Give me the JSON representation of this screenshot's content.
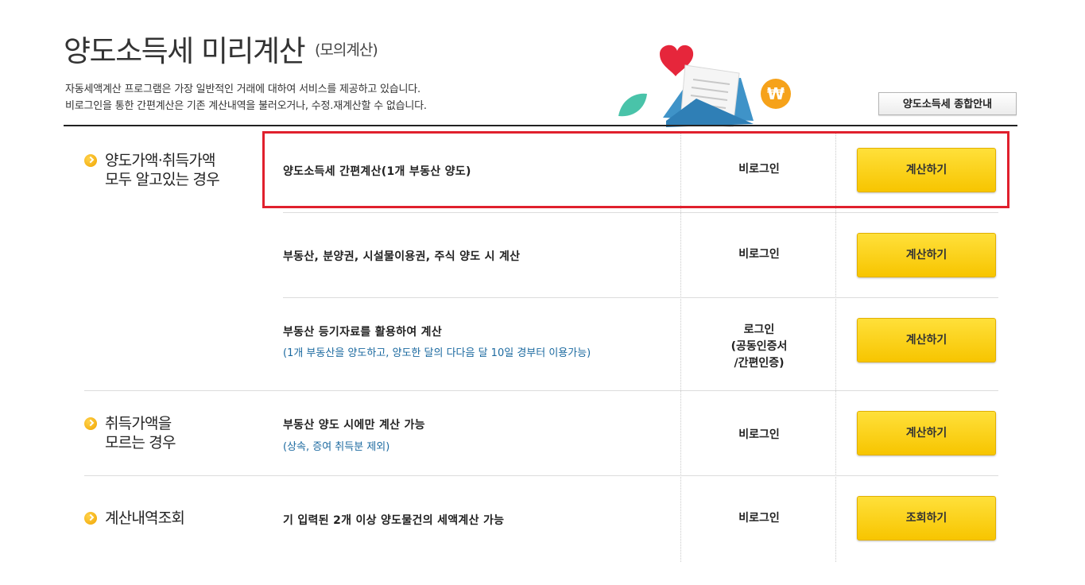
{
  "header": {
    "title": "양도소득세 미리계산",
    "subtitle": "(모의계산)",
    "desc_line1": "자동세액계산 프로그램은 가장 일반적인 거래에 대하여 서비스를 제공하고 있습니다.",
    "desc_line2": "비로그인을 통한 간편계산은 기존 계산내역을 불러오거나, 수정.재계산할 수 없습니다.",
    "guide_button": "양도소득세 종합안내"
  },
  "categories": [
    {
      "line1": "양도가액·취득가액",
      "line2": "모두 알고있는 경우"
    },
    {
      "line1": "취득가액을",
      "line2": "모르는 경우"
    },
    {
      "line1": "계산내역조회",
      "line2": ""
    }
  ],
  "rows": [
    {
      "title": "양도소득세 간편계산(1개 부동산 양도)",
      "note": "",
      "login": "비로그인",
      "button": "계산하기"
    },
    {
      "title": "부동산, 분양권, 시설물이용권, 주식 양도 시 계산",
      "note": "",
      "login": "비로그인",
      "button": "계산하기"
    },
    {
      "title": "부동산 등기자료를 활용하여 계산",
      "note": "(1개 부동산을 양도하고, 양도한 달의 다다음 달 10일 경부터 이용가능)",
      "login_l1": "로그인",
      "login_l2": "(공동인증서",
      "login_l3": "/간편인증)",
      "button": "계산하기"
    },
    {
      "title": "부동산 양도 시에만 계산 가능",
      "note": "(상속, 증여 취득분 제외)",
      "login": "비로그인",
      "button": "계산하기"
    },
    {
      "title": "기 입력된 2개 이상 양도물건의 세액계산 가능",
      "note": "",
      "login": "비로그인",
      "button": "조회하기"
    }
  ],
  "colors": {
    "accent_button": "#f7c500",
    "highlight_border": "#e0202d",
    "note_text": "#1c6aa0"
  }
}
